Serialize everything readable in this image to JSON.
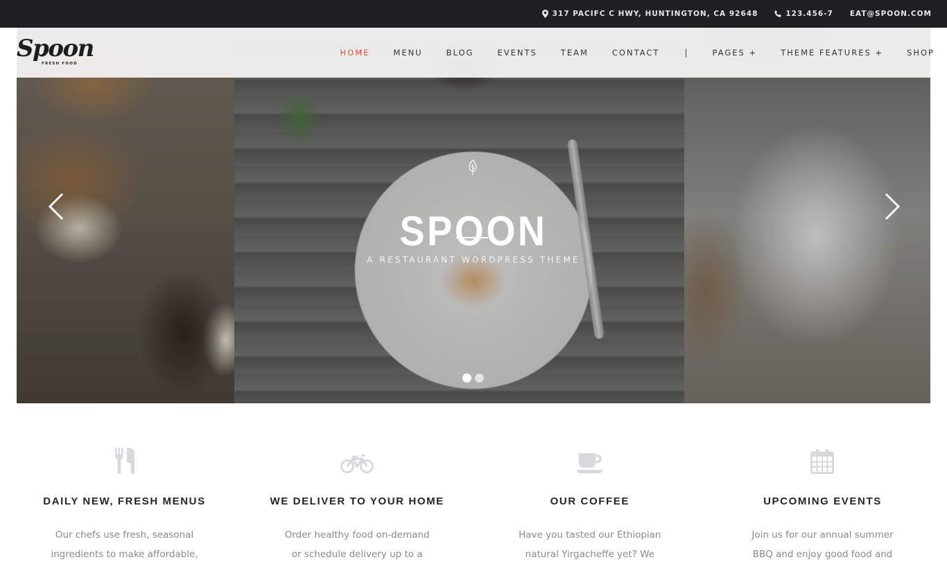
{
  "topbar": {
    "address": "317 PACIFC C HWY, HUNTINGTON, CA 92648",
    "phone": "123.456-7",
    "email": "EAT@SPOON.COM",
    "icons": {
      "address": "map-marker-icon",
      "phone": "phone-icon"
    }
  },
  "header": {
    "logo_text": "Spoon",
    "logo_tagline": "FRESH FOOD",
    "nav": [
      {
        "label": "HOME",
        "active": true
      },
      {
        "label": "MENU"
      },
      {
        "label": "BLOG"
      },
      {
        "label": "EVENTS"
      },
      {
        "label": "TEAM"
      },
      {
        "label": "CONTACT"
      },
      {
        "label": "|"
      },
      {
        "label": "PAGES +"
      },
      {
        "label": "THEME FEATURES +"
      },
      {
        "label": "SHOP"
      }
    ],
    "accent_color": "#e2543f"
  },
  "hero": {
    "icon": "leaf-icon",
    "title": "SPOON",
    "subtitle": "A RESTAURANT WORDPRESS THEME",
    "slide_count": 2,
    "active_slide": 1
  },
  "features": [
    {
      "icon": "cutlery-icon",
      "title": "DAILY NEW, FRESH MENUS",
      "text": [
        "Our chefs use fresh, seasonal",
        "ingredients to make affordable,"
      ]
    },
    {
      "icon": "bicycle-icon",
      "title": "WE DELIVER TO YOUR HOME",
      "text": [
        "Order healthy food on-demand",
        "or schedule delivery up to a"
      ]
    },
    {
      "icon": "coffee-cup-icon",
      "title": "OUR COFFEE",
      "text": [
        "Have you tasted our Ethiopian",
        "natural Yirgacheffe yet? We"
      ]
    },
    {
      "icon": "calendar-icon",
      "title": "UPCOMING EVENTS",
      "text": [
        "Join us for our annual summer",
        "BBQ and enjoy good food and"
      ]
    }
  ]
}
